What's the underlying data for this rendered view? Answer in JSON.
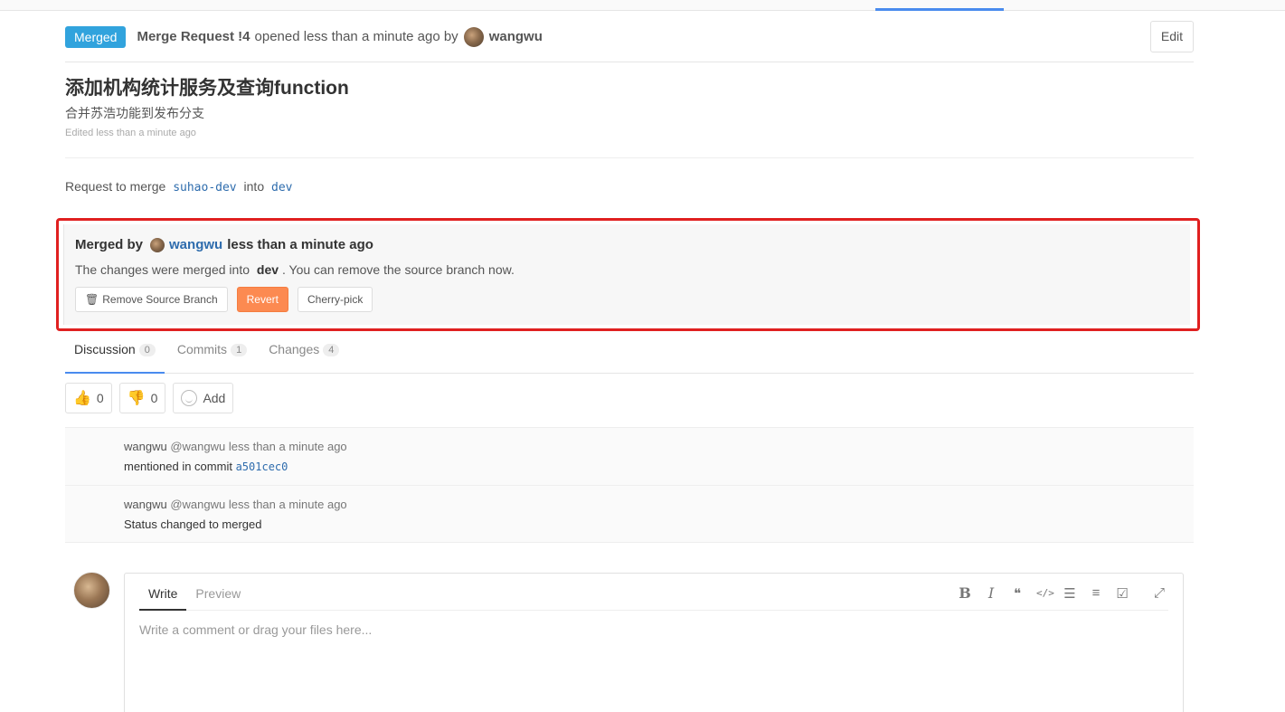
{
  "header": {
    "status_badge": "Merged",
    "mr_ref": "Merge Request !4",
    "opened_text": "opened less than a minute ago by",
    "author": "wangwu",
    "edit_label": "Edit"
  },
  "mr": {
    "title": "添加机构统计服务及查询function",
    "description": "合并苏浩功能到发布分支",
    "edited": "Edited less than a minute ago",
    "request_prefix": "Request to merge",
    "source_branch": "suhao-dev",
    "into_text": "into",
    "target_branch": "dev"
  },
  "merged_widget": {
    "merged_by_label": "Merged by",
    "user": "wangwu",
    "time": "less than a minute ago",
    "note_prefix": "The changes were merged into",
    "note_branch": "dev",
    "note_suffix": ". You can remove the source branch now.",
    "remove_branch_label": "Remove Source Branch",
    "revert_label": "Revert",
    "cherry_pick_label": "Cherry-pick"
  },
  "tabs": [
    {
      "label": "Discussion",
      "count": "0"
    },
    {
      "label": "Commits",
      "count": "1"
    },
    {
      "label": "Changes",
      "count": "4"
    }
  ],
  "awards": {
    "thumbs_up": "0",
    "thumbs_down": "0",
    "add_label": "Add"
  },
  "notes": [
    {
      "author": "wangwu",
      "handle": "@wangwu",
      "time": "less than a minute ago",
      "body_prefix": "mentioned in commit",
      "commit": "a501cec0"
    },
    {
      "author": "wangwu",
      "handle": "@wangwu",
      "time": "less than a minute ago",
      "body_prefix": "Status changed to merged",
      "commit": ""
    }
  ],
  "comment": {
    "write_tab": "Write",
    "preview_tab": "Preview",
    "placeholder": "Write a comment or drag your files here..."
  },
  "colors": {
    "merged_badge": "#31a3dd",
    "revert_button": "#fc8a51",
    "highlight_border": "#e02020",
    "link": "#2e6cad"
  }
}
